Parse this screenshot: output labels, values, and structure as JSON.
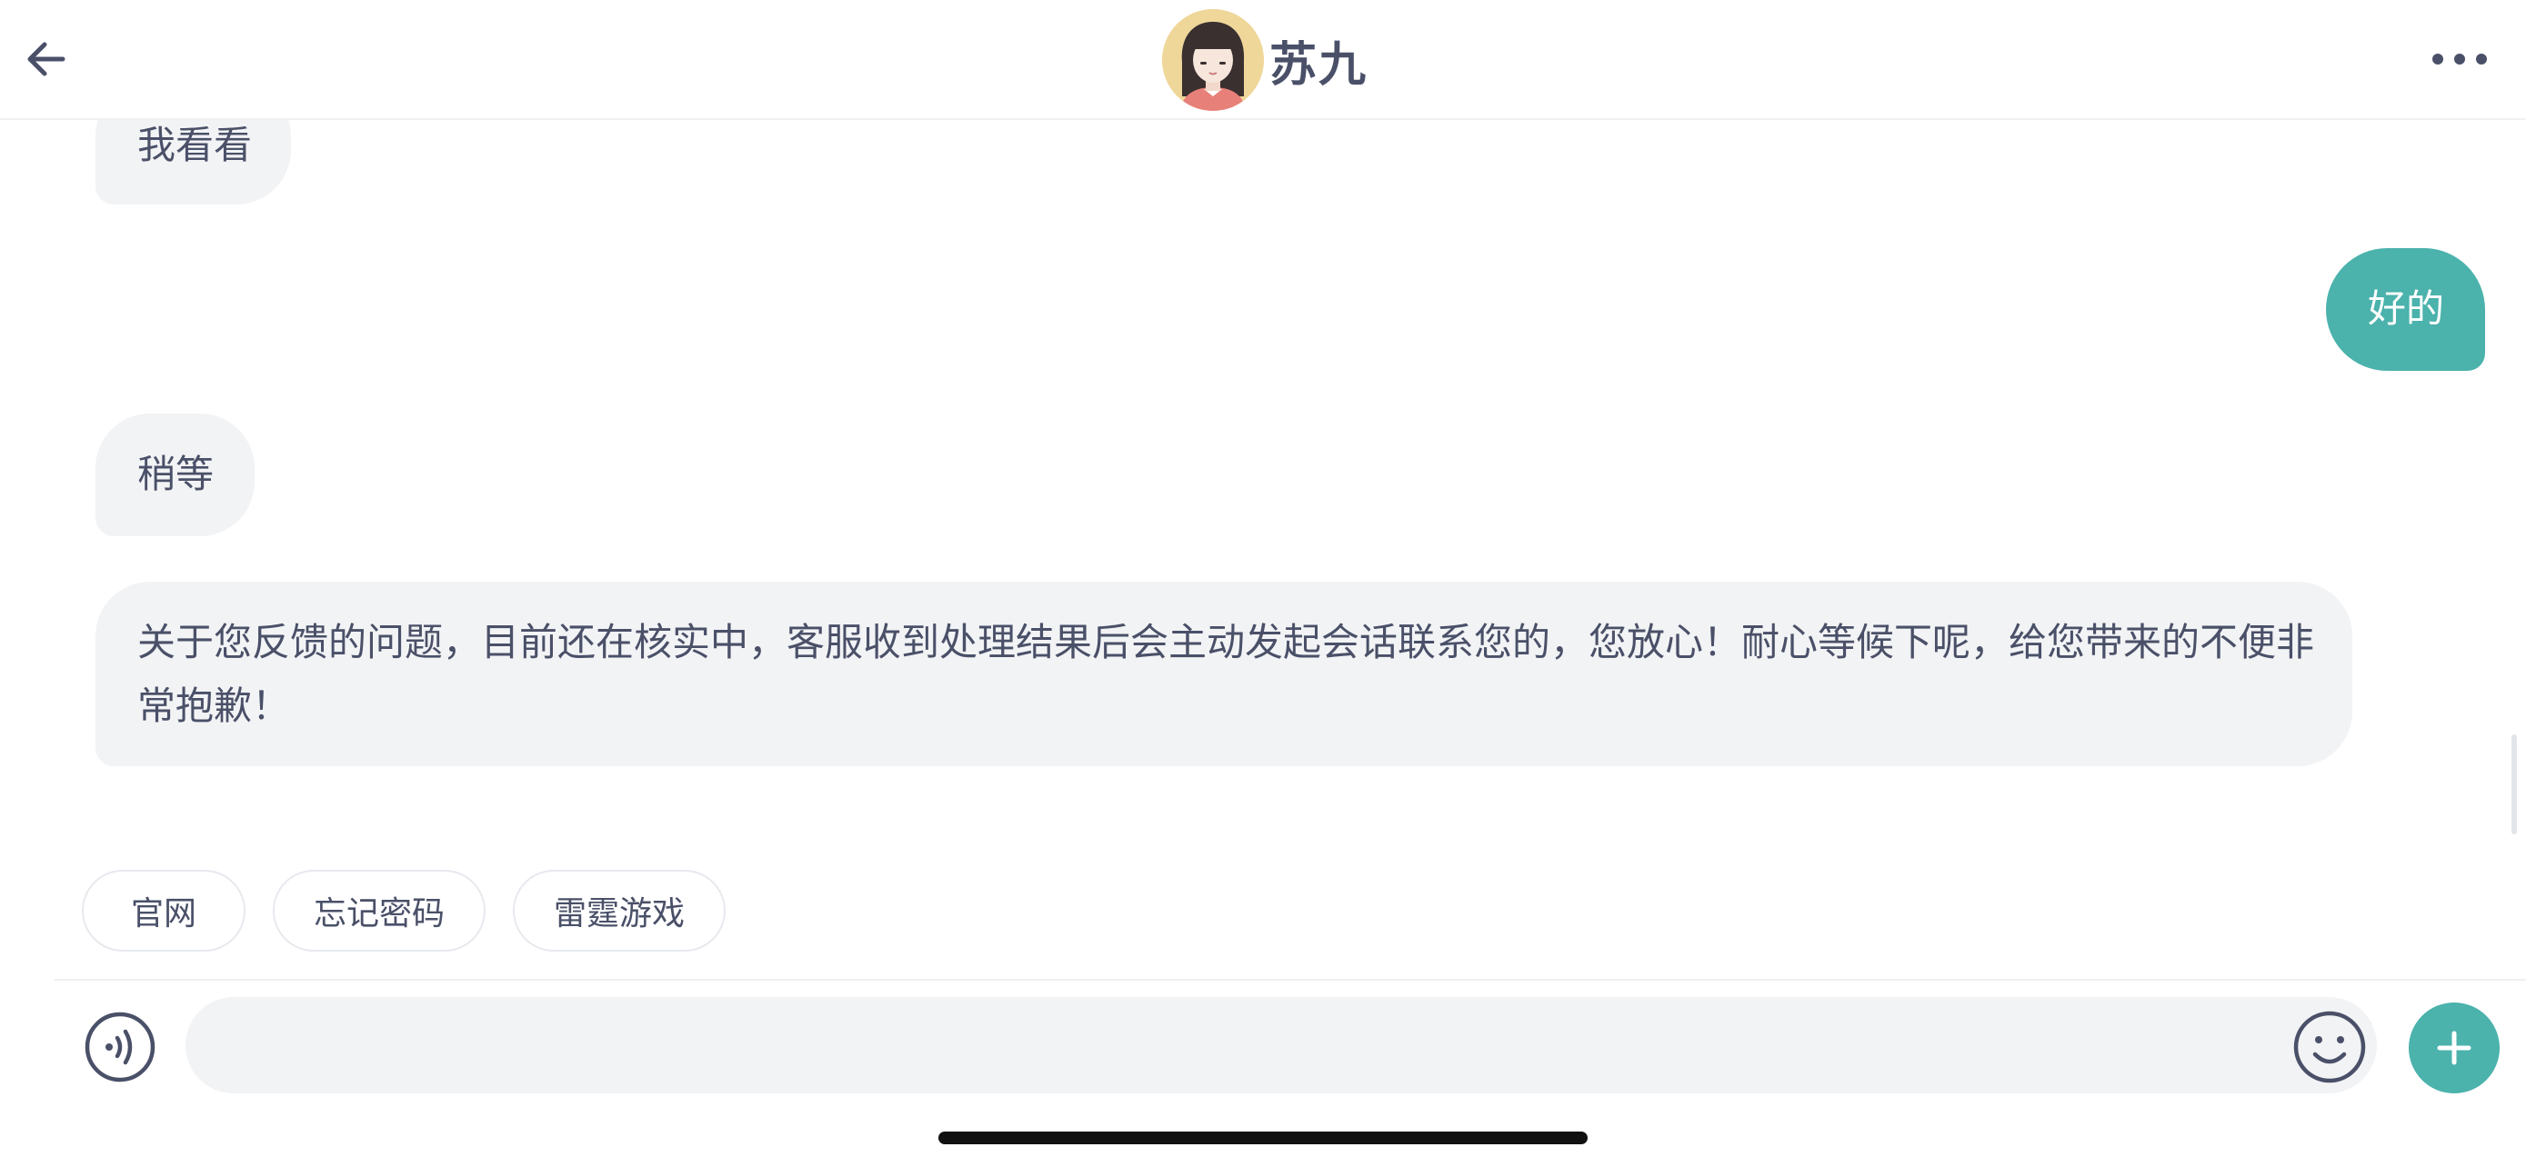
{
  "header": {
    "title": "苏九",
    "back_icon": "arrow-left-icon",
    "more_icon": "more-horizontal-icon",
    "avatar_colors": {
      "background": "#efd79a",
      "hair": "#3a3030",
      "face": "#f6e6dc",
      "shirt": "#e8807a"
    }
  },
  "messages": [
    {
      "side": "in",
      "text": "我看看"
    },
    {
      "side": "out",
      "text": "好的"
    },
    {
      "side": "in",
      "text": "稍等"
    },
    {
      "side": "in",
      "text": "关于您反馈的问题，目前还在核实中，客服收到处理结果后会主动发起会话联系您的，您放心！耐心等候下呢，给您带来的不便非常抱歉！"
    }
  ],
  "quick_replies": [
    {
      "label": "官网"
    },
    {
      "label": "忘记密码"
    },
    {
      "label": "雷霆游戏"
    }
  ],
  "input_bar": {
    "voice_icon": "voice-icon",
    "emoji_icon": "emoji-icon",
    "plus_icon": "plus-icon",
    "value": "",
    "placeholder": ""
  },
  "colors": {
    "accent": "#4bb2ac",
    "bubble_in": "#f2f3f5",
    "text": "#4a5068"
  }
}
